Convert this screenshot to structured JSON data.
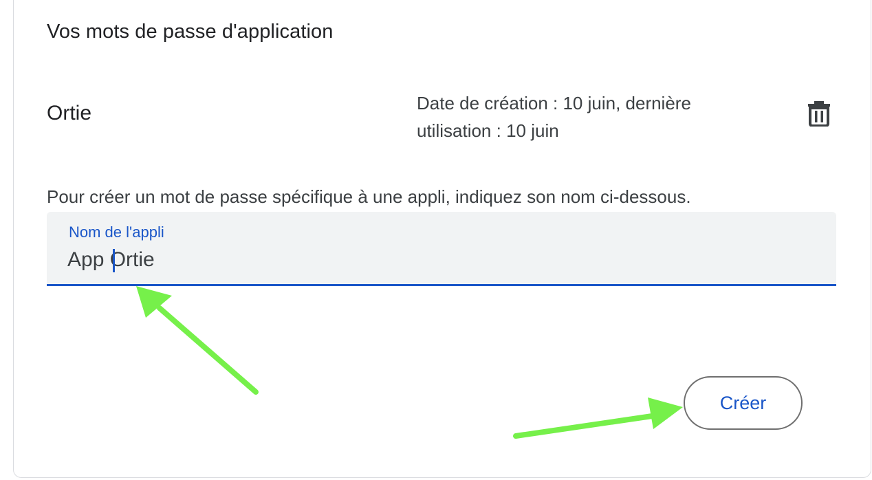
{
  "section": {
    "title": "Vos mots de passe d'application"
  },
  "passwords": [
    {
      "name": "Ortie",
      "meta_line1": "Date de création  : 10 juin, dernière",
      "meta_line2": "utilisation : 10 juin",
      "delete_icon": "trash-icon"
    }
  ],
  "create": {
    "instructions": "Pour créer un mot de passe spécifique à une appli, indiquez son nom ci-dessous.",
    "field_label": "Nom de l'appli",
    "field_value": "App Ortie",
    "button_label": "Créer"
  },
  "colors": {
    "accent": "#1a56c8",
    "field_bg": "#f1f3f4",
    "arrow": "#76f04a"
  }
}
